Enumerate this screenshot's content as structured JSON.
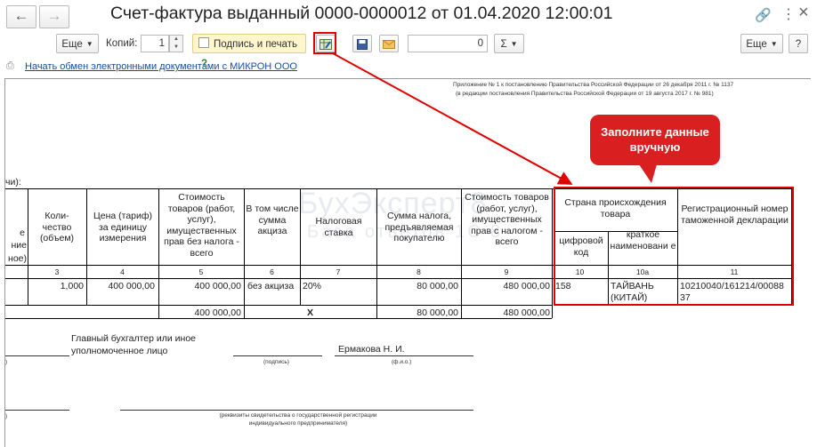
{
  "nav": {
    "back_icon": "←",
    "forward_icon": "→"
  },
  "window": {
    "title": "Счет-фактура выданный 0000-0000012 от 01.04.2020 12:00:01",
    "link_icon": "🔗",
    "more_icon": "⋮",
    "close_icon": "×"
  },
  "toolbar": {
    "more_label": "Еще",
    "copies_label": "Копий:",
    "copies_value": "1",
    "sign_label": "Подпись и печать",
    "help_label": "?",
    "sum_value": "0",
    "sigma_label": "Σ",
    "more_right_label": "Еще",
    "help_right_label": "?"
  },
  "edo": {
    "link_text": "Начать обмен электронными документами с МИКРОН ООО"
  },
  "doc": {
    "appendix_line1": "Приложение № 1 к постановлению Правительства Российской Федерации от 26 декабря 2011 г. № 1137",
    "appendix_line2": "(в редакции постановления Правительства Российской Федерации от 19 августа 2017 г. № 981)",
    "currency_fragment": "чи):",
    "headers": {
      "h2_cut_a": "е",
      "h2_cut_b": "ние",
      "h2_cut_c": "ное)",
      "h3": "Коли- чество (объем)",
      "h4": "Цена (тариф) за единицу измерения",
      "h5": "Стоимость товаров (работ, услуг), имущественных прав без налога - всего",
      "h6": "В том числе сумма акциза",
      "h7": "Налоговая ставка",
      "h8": "Сумма налога, предъявляемая покупателю",
      "h9": "Стоимость товаров (работ, услуг), имущественных прав с налогом - всего",
      "h10": "Страна происхождения товара",
      "h10_code": "цифровой код",
      "h10a": "краткое наименовани е",
      "h11": "Регистрационный номер таможенной декларации"
    },
    "col_numbers": [
      "3",
      "4",
      "5",
      "6",
      "7",
      "8",
      "9",
      "10",
      "10а",
      "11"
    ],
    "row": {
      "qty": "1,000",
      "price": "400 000,00",
      "cost_no_tax": "400 000,00",
      "excise": "без акциза",
      "rate": "20%",
      "tax": "80 000,00",
      "cost_with_tax": "480 000,00",
      "country_code": "158",
      "country_name": "ТАЙВАНЬ (КИТАЙ)",
      "declaration": "10210040/161214/00088 37"
    },
    "total": {
      "cost_no_tax": "400 000,00",
      "excise": "X",
      "tax": "80 000,00",
      "cost_with_tax": "480 000,00"
    },
    "chief_accountant_label": "Главный бухгалтер или иное уполномоченное лицо",
    "signature_caption": "(подпись)",
    "accountant_name": "Ермакова Н. И.",
    "fio_caption": "(ф.и.о.)",
    "edge_paren_1": ")",
    "edge_paren_2": ")",
    "certificate_caption": "(реквизиты свидетельства о государственной регистрации индивидуального предпринимателя)"
  },
  "watermark": {
    "brand": "БухЭксперт8",
    "tagline": "База ответов 1С 8"
  },
  "callout": {
    "text": "Заполните данные вручную"
  },
  "colors": {
    "accent_red": "#e00000",
    "callout_bg": "#d91f1f",
    "yellow_btn": "#fff6cc",
    "link_blue": "#1a4b9c"
  }
}
